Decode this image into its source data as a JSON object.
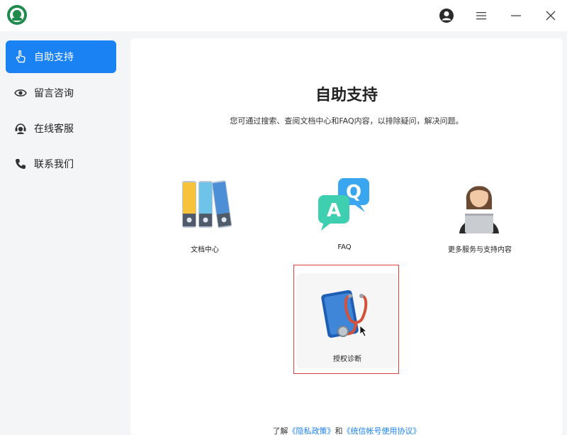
{
  "window": {
    "controls": {
      "account_icon": "user-circle-icon",
      "menu_icon": "hamburger-menu-icon",
      "minimize_icon": "minimize-icon",
      "close_icon": "close-icon"
    }
  },
  "sidebar": {
    "items": [
      {
        "label": "自助支持",
        "icon": "hand-pointer-icon",
        "active": true
      },
      {
        "label": "留言咨询",
        "icon": "message-eye-icon",
        "active": false
      },
      {
        "label": "在线客服",
        "icon": "headset-agent-icon",
        "active": false
      },
      {
        "label": "联系我们",
        "icon": "phone-icon",
        "active": false
      }
    ]
  },
  "main": {
    "title": "自助支持",
    "subtitle": "您可通过搜索、查阅文档中心和FAQ内容，以排除疑问，解决问题。",
    "cards": [
      {
        "label": "文档中心",
        "icon": "binders-icon"
      },
      {
        "label": "FAQ",
        "icon": "qa-chat-bubbles-icon"
      },
      {
        "label": "更多服务与支持内容",
        "icon": "support-agent-icon"
      },
      {
        "label": "授权诊断",
        "icon": "stethoscope-diagnosis-icon"
      }
    ],
    "footer": {
      "prefix": "了解",
      "privacy_link": "《隐私政策》",
      "and": "和",
      "agreement_link": "《统信帐号使用协议》"
    }
  },
  "colors": {
    "accent": "#1a82f2",
    "highlight_border": "#e04040"
  }
}
